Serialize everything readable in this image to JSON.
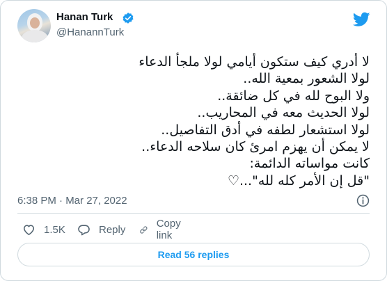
{
  "author": {
    "name": "Hanan Turk",
    "handle": "@HanannTurk",
    "avatar_icon": "profile-photo",
    "verified_icon": "verified-badge-icon"
  },
  "tweet": {
    "lines": [
      "لا أدري كيف ستكون أيامي لولا ملجأ الدعاء",
      "لولا الشعور بمعية الله..",
      "ولا البوح لله في كل ضائقة..",
      "لولا الحديث معه في المحاريب..",
      "لولا استشعار لطفه في أدق التفاصيل..",
      "لا يمكن أن يهزم امرئ كان سلاحه الدعاء..",
      "كانت مواساته الدائمة:",
      "\"قل إن الأمر كله لله\"...♡"
    ],
    "timestamp": "6:38 PM · Mar 27, 2022"
  },
  "actions": {
    "like_count": "1.5K",
    "reply_label": "Reply",
    "copy_link_label": "Copy link"
  },
  "read_replies_label": "Read 56 replies",
  "colors": {
    "accent": "#1d9bf0",
    "text": "#0f1419",
    "muted": "#536471",
    "border": "#cfd9de"
  }
}
